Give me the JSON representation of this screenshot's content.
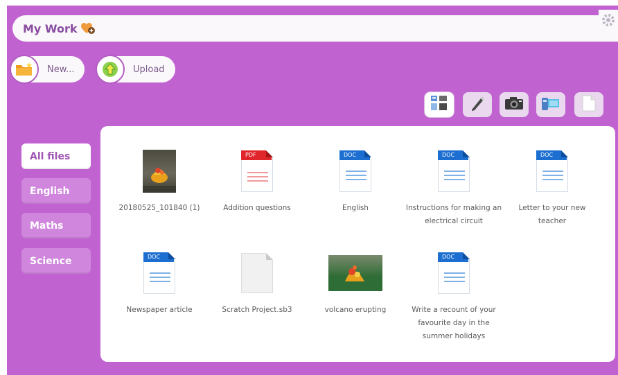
{
  "header": {
    "title": "My Work"
  },
  "actions": {
    "new_label": "New...",
    "upload_label": "Upload"
  },
  "toolbar": {
    "tools": [
      {
        "name": "mixed-media-icon",
        "active": true
      },
      {
        "name": "pen-icon",
        "active": false
      },
      {
        "name": "camera-icon",
        "active": false
      },
      {
        "name": "video-camera-icon",
        "active": false
      },
      {
        "name": "blank-document-icon",
        "active": false
      }
    ]
  },
  "sidebar": {
    "items": [
      {
        "label": "All files",
        "active": true
      },
      {
        "label": "English",
        "active": false
      },
      {
        "label": "Maths",
        "active": false
      },
      {
        "label": "Science",
        "active": false
      }
    ]
  },
  "files": [
    {
      "name": "20180525_101840 (1)",
      "kind": "photo"
    },
    {
      "name": "Addition questions",
      "kind": "PDF"
    },
    {
      "name": "English",
      "kind": "DOC"
    },
    {
      "name": "Instructions for making an electrical circuit",
      "kind": "DOC"
    },
    {
      "name": "Letter to your new teacher",
      "kind": "DOC"
    },
    {
      "name": "Newspaper article",
      "kind": "DOC"
    },
    {
      "name": "Scratch Project.sb3",
      "kind": "blank"
    },
    {
      "name": "volcano erupting",
      "kind": "photo"
    },
    {
      "name": "Write a recount of your favourite day in the summer holidays",
      "kind": "DOC"
    }
  ],
  "colors": {
    "background": "#c063d0",
    "panel": "#ffffff",
    "sidebar_button": "#cf86dc",
    "doc_blue": "#1c6fd0",
    "pdf_red": "#e0252b"
  }
}
